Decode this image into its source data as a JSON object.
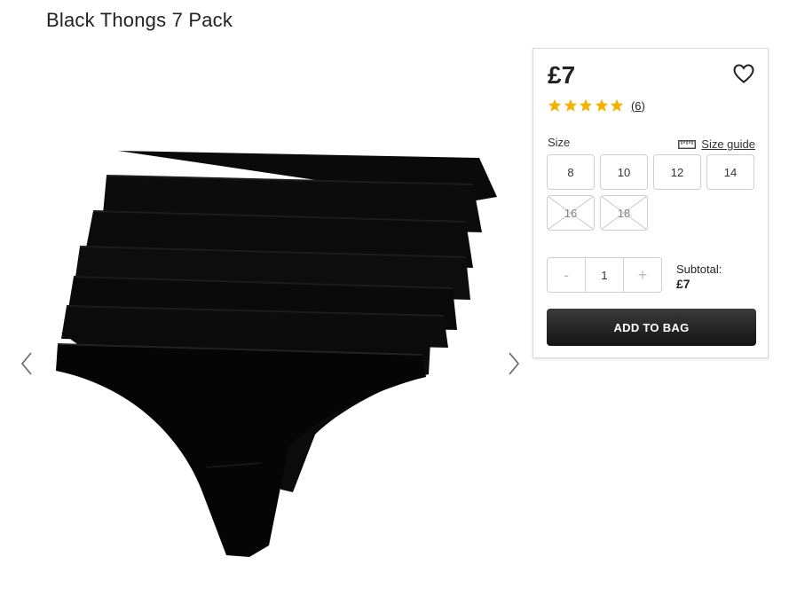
{
  "product": {
    "title": "Black Thongs 7 Pack",
    "price": "£7",
    "rating_stars": 5,
    "review_count": "(6)"
  },
  "size": {
    "label": "Size",
    "guide_label": "Size guide",
    "options": [
      {
        "label": "8",
        "available": true
      },
      {
        "label": "10",
        "available": true
      },
      {
        "label": "12",
        "available": true
      },
      {
        "label": "14",
        "available": true
      },
      {
        "label": "16",
        "available": false
      },
      {
        "label": "18",
        "available": false
      }
    ]
  },
  "quantity": {
    "minus": "-",
    "value": "1",
    "plus": "+"
  },
  "subtotal": {
    "label": "Subtotal:",
    "amount": "£7"
  },
  "add_to_bag_label": "ADD TO BAG",
  "colors": {
    "star": "#f5b301",
    "button_dark": "#1e1e1e"
  }
}
